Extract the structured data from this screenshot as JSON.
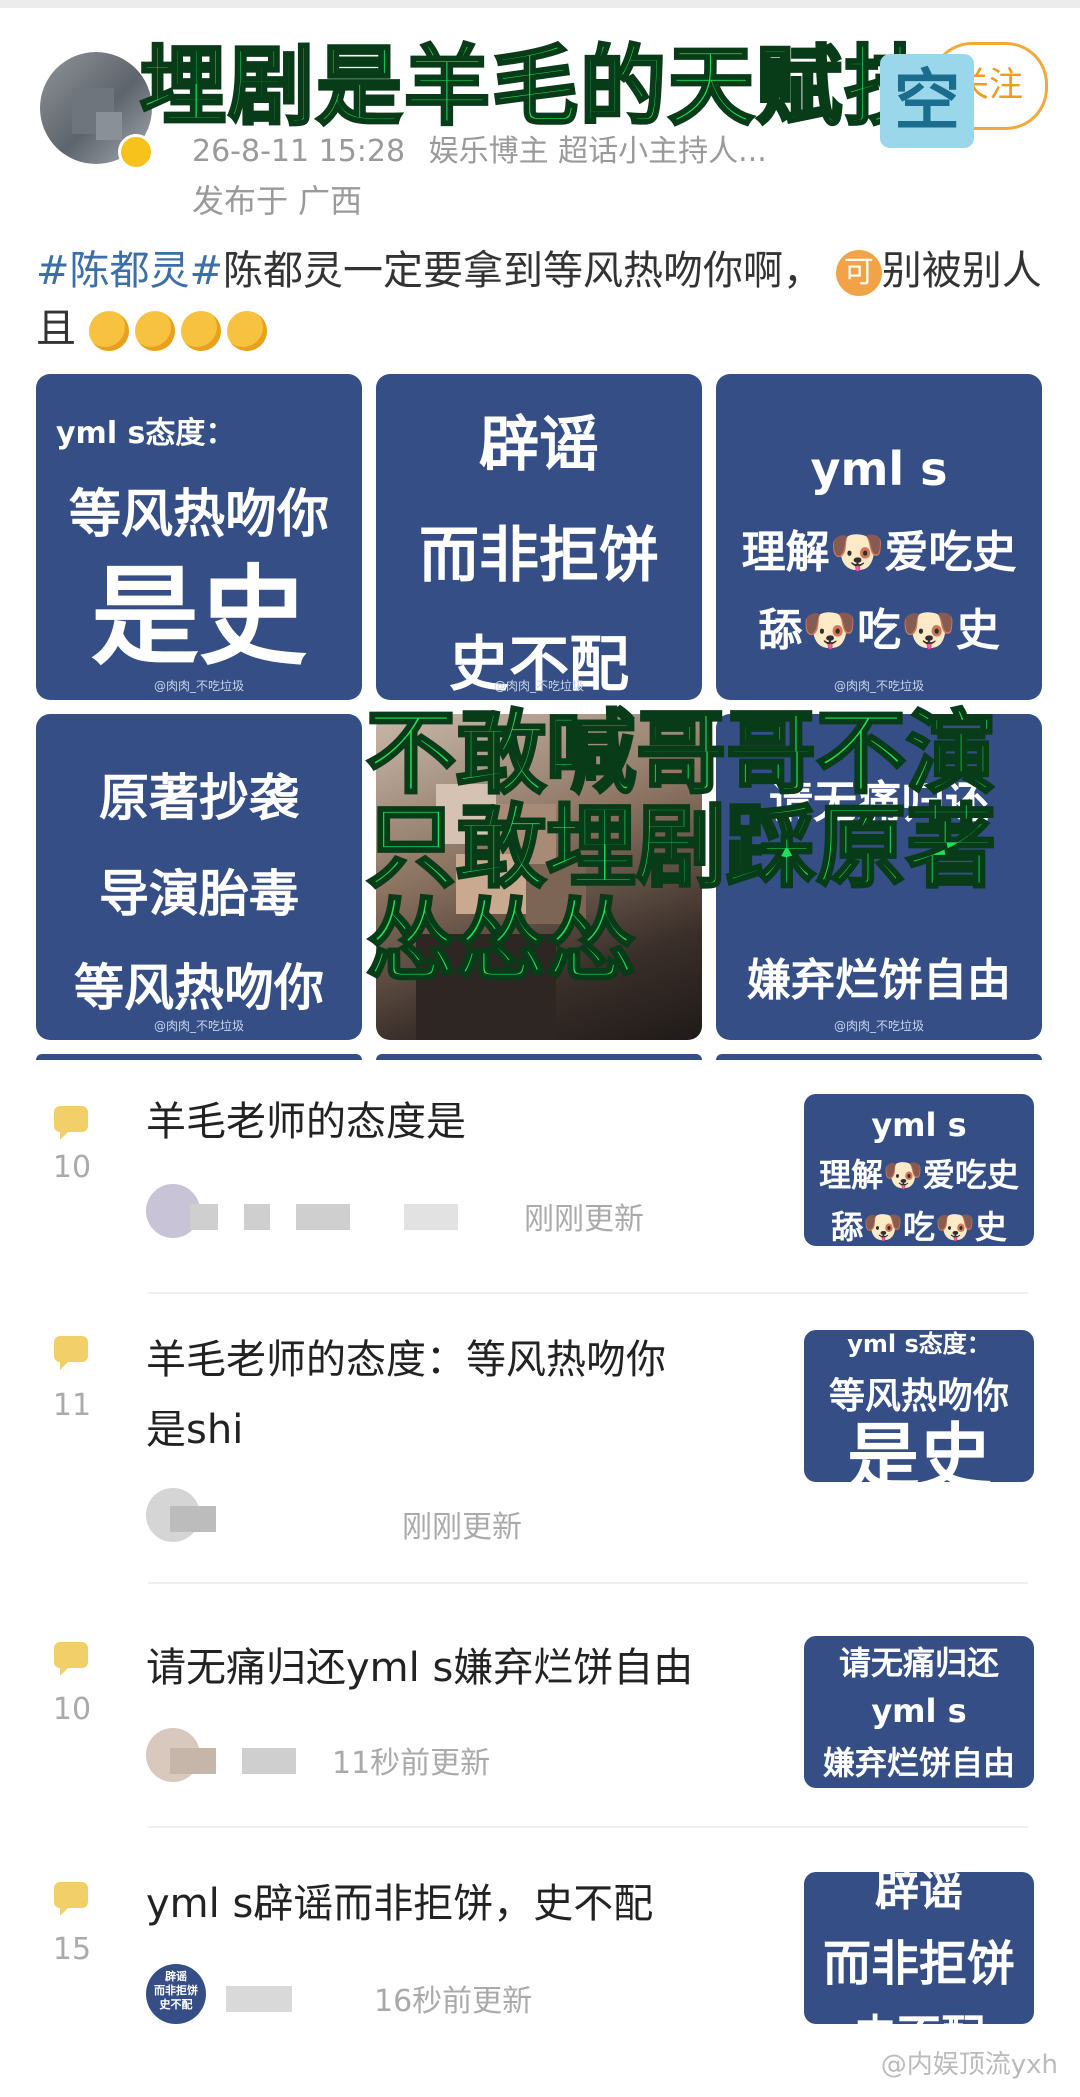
{
  "header": {
    "overlay_title": "埋剧是羊毛的天赋技",
    "overlay_kong": "空",
    "follow_label": "关注",
    "timestamp": "26-8-11 15:28",
    "user_desc": "娱乐博主 超话小主持人...",
    "location": "发布于 广西"
  },
  "post": {
    "tags": "#陈都灵#",
    "text_a": "陈都灵一定要拿到等风热吻你啊，",
    "ke_badge": "可",
    "text_b": "别被别人且"
  },
  "grid": {
    "t1": {
      "l1": "yml s态度：",
      "l2": "等风热吻你",
      "l3": "是史"
    },
    "t2": {
      "l1": "辟谣",
      "l2": "而非拒饼",
      "l3": "史不配"
    },
    "t3": {
      "l1": "yml s",
      "l2": "理解🐶爱吃史",
      "l3": "舔🐶吃🐶史"
    },
    "t4": {
      "l1": "原著抄袭",
      "l2": "导演胎毒",
      "l3": "等风热吻你"
    },
    "t6": {
      "l1": "请无痛归还",
      "l3": "嫌弃烂饼自由"
    },
    "watermark": "@肉肉_不吃垃圾",
    "overlay_lines": [
      "不敢喊哥哥不演",
      "只敢埋剧踩原著",
      "怂怂怂"
    ]
  },
  "comments": [
    {
      "count": "10",
      "text": "羊毛老师的态度是",
      "time": "刚刚更新",
      "thumb": [
        "yml s",
        "理解🐶爱吃史",
        "舔🐶吃🐶史"
      ]
    },
    {
      "count": "11",
      "text_l1": "羊毛老师的态度：等风热吻你",
      "text_l2": "是shi",
      "time": "刚刚更新",
      "thumb": [
        "yml s态度：",
        "等风热吻你",
        "是史"
      ]
    },
    {
      "count": "10",
      "text": "请无痛归还yml s嫌弃烂饼自由",
      "time": "11秒前更新",
      "thumb": [
        "请无痛归还",
        "yml s",
        "嫌弃烂饼自由"
      ]
    },
    {
      "count": "15",
      "text": "yml s辟谣而非拒饼，史不配",
      "time": "16秒前更新",
      "thumb": [
        "辟谣",
        "而非拒饼",
        "史不配"
      ],
      "avatar_text": [
        "辟谣",
        "而非拒饼",
        "史不配"
      ]
    }
  ],
  "footer": {
    "watermark": "@内娱顶流yxh"
  },
  "colors": {
    "tile": "#354f86",
    "overlay_green": "#1fe05c",
    "link": "#3c6ea8",
    "follow": "#f09a1e"
  }
}
